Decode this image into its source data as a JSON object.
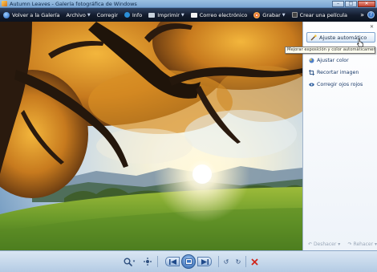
{
  "window": {
    "title": "Autumn Leaves - Galería fotográfica de Windows",
    "minimize": "–",
    "maximize": "□",
    "close": "✕"
  },
  "toolbar": {
    "back_label": "Volver a la Galería",
    "file_label": "Archivo",
    "fix_label": "Corregir",
    "info_label": "Info",
    "print_label": "Imprimir",
    "email_label": "Correo electrónico",
    "burn_label": "Grabar",
    "movie_label": "Crear una película",
    "more": "»",
    "help": "?"
  },
  "fix_panel": {
    "close": "✕",
    "auto_adjust_label": "Ajuste automático",
    "tooltip": "Mejorar exposición y color automáticamente",
    "items": [
      {
        "label": "Ajustar color",
        "icon": "color-icon"
      },
      {
        "label": "Recortar imagen",
        "icon": "crop-icon"
      },
      {
        "label": "Corregir ojos rojos",
        "icon": "red-eye-icon"
      }
    ],
    "undo_label": "Deshacer",
    "redo_label": "Rehacer"
  },
  "colors": {
    "toolbar_bg": "#121b2c",
    "panel_link": "#1b3b6a",
    "bottom_bg": "#b4cbe4"
  }
}
